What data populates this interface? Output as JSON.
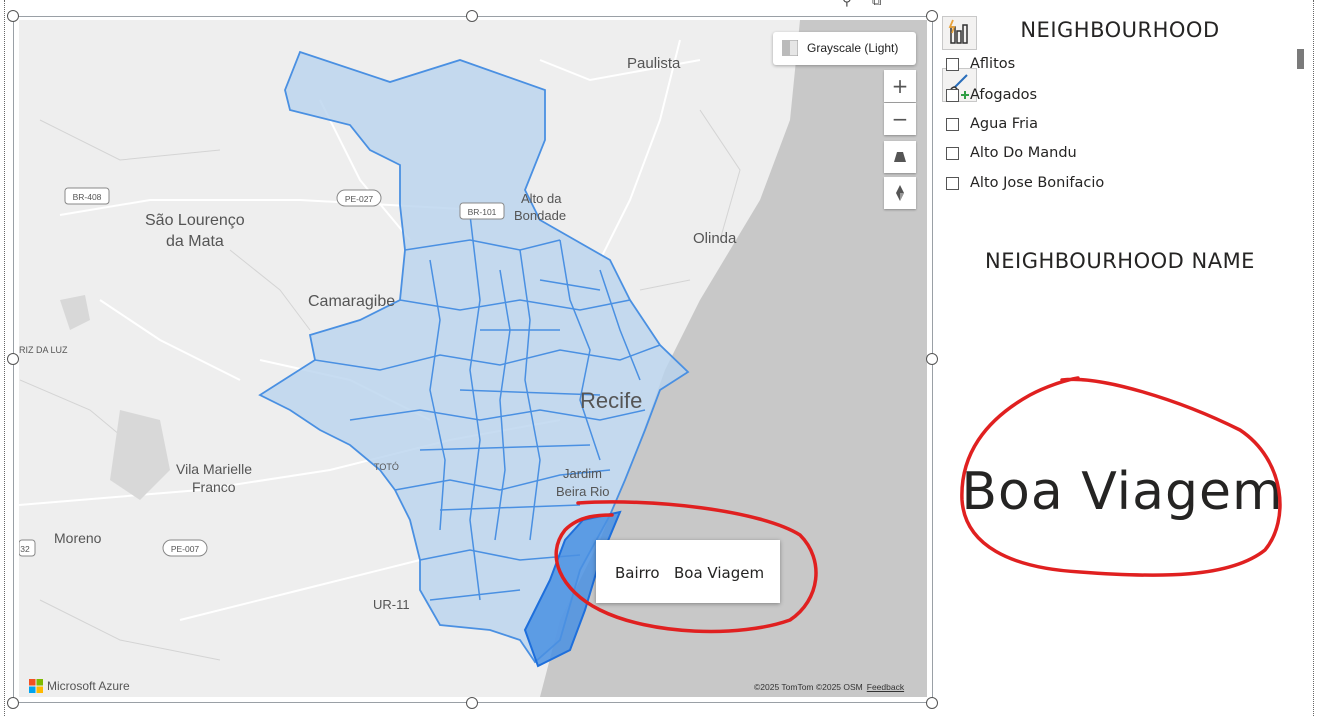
{
  "map": {
    "style_label": "Grayscale (Light)",
    "attribution": "Microsoft Azure",
    "copyright": "©2025 TomTom  ©2025 OSM",
    "feedback_label": "Feedback",
    "controls": {
      "zoom_in": "+",
      "zoom_out": "−"
    },
    "labels": {
      "paulista": "Paulista",
      "alto_da_bondade_1": "Alto da",
      "alto_da_bondade_2": "Bondade",
      "sao_lourenco_1": "São Lourenço",
      "sao_lourenco_2": "da Mata",
      "olinda": "Olinda",
      "camaragibe": "Camaragibe",
      "recife": "Recife",
      "jardim_1": "Jardim",
      "jardim_2": "Beira Rio",
      "vila_marielle_1": "Vila Marielle",
      "vila_marielle_2": "Franco",
      "moreno": "Moreno",
      "ur11": "UR-11",
      "toto": "TOTÓ",
      "riz_da_luz": "RIZ DA LUZ",
      "br408": "BR-408",
      "pe027": "PE-027",
      "br101": "BR-101",
      "pe007": "PE-007",
      "n32": "32"
    },
    "tooltip": {
      "field": "Bairro",
      "value": "Boa Viagem"
    },
    "colors": {
      "region_fill": "#b9d3ee",
      "region_stroke": "#4a90e2",
      "selected_fill": "#4a90e2",
      "sea": "#c8c8c8",
      "land": "#eeeeee",
      "annotation": "#e02020"
    }
  },
  "slicer": {
    "title": "NEIGHBOURHOOD",
    "items": [
      "Aflitos",
      "Afogados",
      "Agua Fria",
      "Alto Do Mandu",
      "Alto Jose Bonifacio"
    ]
  },
  "card": {
    "title": "NEIGHBOURHOOD NAME",
    "value": "Boa Viagem"
  }
}
